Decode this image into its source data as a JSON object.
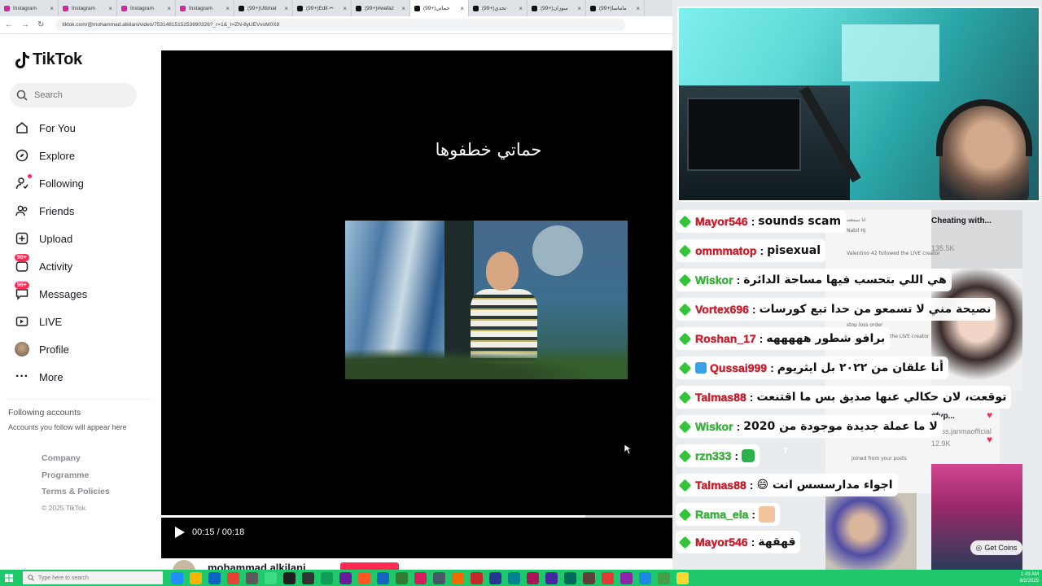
{
  "browser": {
    "tabs": [
      {
        "title": "Instagram",
        "kind": "ig"
      },
      {
        "title": "Instagram",
        "kind": "ig"
      },
      {
        "title": "Instagram",
        "kind": "ig"
      },
      {
        "title": "Instagram",
        "kind": "ig"
      },
      {
        "title": "(99+)Ultimat",
        "kind": "tt"
      },
      {
        "title": "(99+)Edit ✂",
        "kind": "tt"
      },
      {
        "title": "(99+)#wafaz",
        "kind": "tt"
      },
      {
        "title": "(99+)حماتي",
        "kind": "tt"
      },
      {
        "title": "(99+)تحدي",
        "kind": "tt"
      },
      {
        "title": "(99+)سوزان",
        "kind": "tt"
      },
      {
        "title": "(99+)ماماسا",
        "kind": "tt"
      }
    ],
    "url": "tiktok.com/@mohammad.alkilani/video/7531481515253890326?_r=1&_t=ZN-8yUEVvoM0X8"
  },
  "sidebar": {
    "logo_text": "TikTok",
    "search_placeholder": "Search",
    "items": [
      {
        "label": "For You",
        "icon": "home-icon"
      },
      {
        "label": "Explore",
        "icon": "compass-icon"
      },
      {
        "label": "Following",
        "icon": "following-icon"
      },
      {
        "label": "Friends",
        "icon": "friends-icon"
      },
      {
        "label": "Upload",
        "icon": "upload-icon"
      },
      {
        "label": "Activity",
        "icon": "activity-icon",
        "badge": "99+"
      },
      {
        "label": "Messages",
        "icon": "messages-icon",
        "badge": "99+"
      },
      {
        "label": "LIVE",
        "icon": "live-icon"
      },
      {
        "label": "Profile",
        "icon": "avatar"
      },
      {
        "label": "More",
        "icon": "more-icon"
      }
    ],
    "following_heading": "Following accounts",
    "following_sub": "Accounts you follow will appear here",
    "footer": [
      "Company",
      "Programme",
      "Terms & Policies"
    ],
    "copyright": "© 2025 TikTok"
  },
  "video": {
    "caption": "حماتي خطفوها",
    "time_current": "00:15",
    "time_total": "00:18",
    "progress": 0.83,
    "author": "mohammad.alkilani"
  },
  "chat": [
    {
      "user": "Mayor546",
      "text": "sounds scam",
      "color": "red",
      "rtl": false
    },
    {
      "user": "ommmatop",
      "text": "pisexual",
      "color": "red",
      "rtl": false
    },
    {
      "user": "Wiskor",
      "text": "هي اللي بتحسب فيها مساحة الدائرة",
      "color": "green",
      "rtl": true
    },
    {
      "user": "Vortex696",
      "text": "نصيحة مني لا تسمعو من حدا تبع كورسات",
      "color": "red",
      "rtl": true
    },
    {
      "user": "Roshan_17",
      "text": "برافو شطور هههههه",
      "color": "red",
      "rtl": true
    },
    {
      "user": "Qussai999",
      "text": "أنا علقان من ٢٠٢٢ بل ايثريوم",
      "color": "red",
      "rtl": true
    },
    {
      "user": "Talmas88",
      "text": "توقعت، لان حكالي عنها صديق بس ما اقتنعت",
      "color": "red",
      "rtl": true
    },
    {
      "user": "Wiskor",
      "text": "لا ما عملة جديدة موجودة من 2020",
      "color": "green",
      "rtl": true
    },
    {
      "user": "rzn333",
      "text": "",
      "color": "green",
      "rtl": false
    },
    {
      "user": "Talmas88",
      "text": "اجواء مدارسسس انت 😄",
      "color": "red",
      "rtl": true
    },
    {
      "user": "Rama_ela",
      "text": "",
      "color": "green",
      "rtl": false
    },
    {
      "user": "Mayor546",
      "text": "قهقهة",
      "color": "red",
      "rtl": true
    }
  ],
  "chat_badge": "7",
  "feed": {
    "title1": "Cheating with...",
    "title2": "#fyp...",
    "sub1": "135.5K",
    "sub2": "12.9K",
    "user2": "mass.janmaofficial",
    "lines": [
      "انا سمعته",
      "Nabil Hj",
      "Valentino 42 followed the LIVE creator",
      "stop loss order",
      "followed the LIVE creator",
      "joined from your posts"
    ],
    "get_coins": "Get Coins"
  },
  "taskbar": {
    "search_placeholder": "Type here to search",
    "time": "1:43 AM",
    "date": "8/2/2025"
  },
  "colors": {
    "tiktok_red": "#fe2c55",
    "chat_green": "#36c23a",
    "chat_red": "#e0182a",
    "taskbar": "#1fc96b"
  }
}
